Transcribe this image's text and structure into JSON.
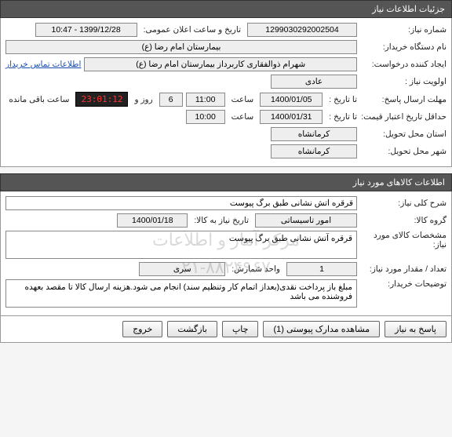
{
  "sections": {
    "need_info_title": "جزئیات اطلاعات نیاز",
    "goods_info_title": "اطلاعات کالاهای مورد نیاز"
  },
  "need": {
    "number_label": "شماره نیاز:",
    "number": "1299030292002504",
    "announce_label": "تاریخ و ساعت اعلان عمومی:",
    "announce": "1399/12/28 - 10:47",
    "buyer_device_label": "نام دستگاه خریدار:",
    "buyer_device": "بیمارستان امام رضا (ع)",
    "requester_label": "ایجاد کننده درخواست:",
    "requester": "شهرام ذوالفقاری کاربرداز بیمارستان امام رضا (ع)",
    "contact_link": "اطلاعات تماس خریدار",
    "priority_label": "اولویت نیاز :",
    "priority": "عادی",
    "deadline_label": "مهلت ارسال پاسخ:",
    "until_label": "تا تاریخ :",
    "deadline_date": "1400/01/05",
    "time_label": "ساعت",
    "deadline_time": "11:00",
    "days": "6",
    "days_label": "روز و",
    "countdown": "23:01:12",
    "remain_label": "ساعت باقی مانده",
    "validity_label": "حداقل تاریخ اعتبار قیمت:",
    "validity_date": "1400/01/31",
    "validity_time": "10:00",
    "delivery_prov_label": "استان محل تحویل:",
    "delivery_prov": "کرمانشاه",
    "delivery_city_label": "شهر محل تحویل:",
    "delivery_city": "کرمانشاه"
  },
  "goods": {
    "title_label": "شرح کلی نیاز:",
    "title": "قرقره آتش نشانی طبق برگ پیوست",
    "group_label": "گروه کالا:",
    "group": "امور تاسیساتی",
    "need_date_label": "تاریخ نیاز به کالا:",
    "need_date": "1400/01/18",
    "spec_label": "مشخصات کالای مورد نیاز:",
    "spec": "قرقره آتش نشانی طبق برگ پیوست",
    "qty_label": "تعداد / مقدار مورد نیاز:",
    "qty": "1",
    "unit_label": "واحد شمارش:",
    "unit": "سری",
    "notes_label": "توضیحات خریدار:",
    "notes": "مبلغ باز پرداخت نقدی(بعداز اتمام کار وتنظیم سند) انجام می شود.هزینه ارسال کالا تا مقصد بعهده فروشنده می باشد"
  },
  "buttons": {
    "respond": "پاسخ به نیاز",
    "attachments": "مشاهده مدارک پیوستی (1)",
    "print": "چاپ",
    "back": "بازگشت",
    "exit": "خروج"
  },
  "watermark": "مرکز آمار و اطلاعات\n۰۲۱-۸۸۲۴۹۶۷۰"
}
